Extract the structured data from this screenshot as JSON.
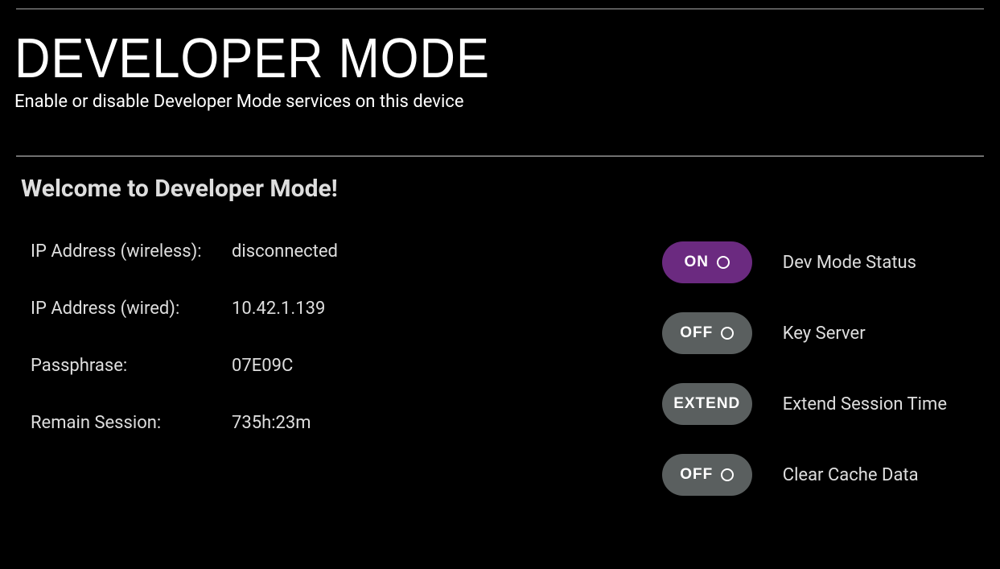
{
  "header": {
    "title": "DEVELOPER MODE",
    "subtitle": "Enable or disable Developer Mode services on this device"
  },
  "welcome": "Welcome to Developer Mode!",
  "info": {
    "ip_wireless_label": "IP Address (wireless):",
    "ip_wireless_value": "disconnected",
    "ip_wired_label": "IP Address (wired):",
    "ip_wired_value": "10.42.1.139",
    "passphrase_label": "Passphrase:",
    "passphrase_value": "07E09C",
    "remain_session_label": "Remain Session:",
    "remain_session_value": "735h:23m"
  },
  "controls": {
    "dev_mode": {
      "state": "ON",
      "label": "Dev Mode Status"
    },
    "key_server": {
      "state": "OFF",
      "label": "Key Server"
    },
    "extend": {
      "button": "EXTEND",
      "label": "Extend Session Time"
    },
    "clear_cache": {
      "state": "OFF",
      "label": "Clear Cache Data"
    }
  }
}
